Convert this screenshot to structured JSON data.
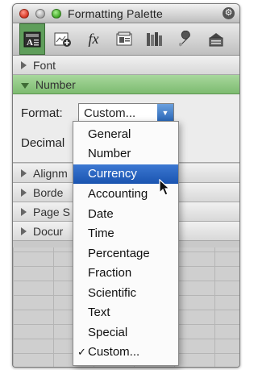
{
  "window": {
    "title": "Formatting Palette"
  },
  "toolbar": {
    "tools": [
      {
        "icon": "text-format-icon",
        "active": true
      },
      {
        "icon": "add-objects-icon",
        "active": false
      },
      {
        "icon": "formula-icon",
        "label": "fx",
        "active": false
      },
      {
        "icon": "scrapbook-icon",
        "active": false
      },
      {
        "icon": "reference-tools-icon",
        "active": false
      },
      {
        "icon": "toolbox-wrench-icon",
        "active": false
      },
      {
        "icon": "compatibility-icon",
        "active": false
      }
    ]
  },
  "sections": {
    "font": "Font",
    "number": "Number",
    "alignment": "Alignm",
    "borders": "Borde",
    "page_setup": "Page S",
    "document": "Docur"
  },
  "number_panel": {
    "format_label": "Format:",
    "format_value": "Custom...",
    "decimal_label": "Decimal"
  },
  "menu": {
    "items": [
      {
        "label": "General"
      },
      {
        "label": "Number"
      },
      {
        "label": "Currency",
        "highlighted": true
      },
      {
        "label": "Accounting"
      },
      {
        "label": "Date"
      },
      {
        "label": "Time"
      },
      {
        "label": "Percentage"
      },
      {
        "label": "Fraction"
      },
      {
        "label": "Scientific"
      },
      {
        "label": "Text"
      },
      {
        "label": "Special"
      },
      {
        "label": "Custom...",
        "checked": true
      }
    ],
    "check_mark": "✓"
  },
  "colors": {
    "accent_green": "#7dbb70",
    "selection_blue": "#1a54b0"
  }
}
